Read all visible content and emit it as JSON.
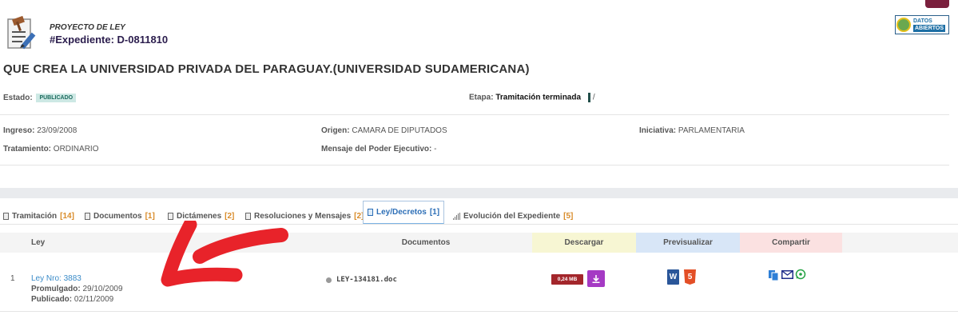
{
  "header": {
    "project_type": "PROYECTO DE LEY",
    "expediente": "#Expediente: D-0811810",
    "datos_line1": "DATOS",
    "datos_line2": "ABIERTOS",
    "title": "QUE CREA LA UNIVERSIDAD PRIVADA DEL PARAGUAY.(UNIVERSIDAD SUDAMERICANA)"
  },
  "status": {
    "estado_label": "Estado:",
    "estado_badge": "PUBLICADO",
    "etapa_label": "Etapa:",
    "etapa_value": "Tramitación terminada",
    "etapa_suffix": "/"
  },
  "info": {
    "ingreso_label": "Ingreso:",
    "ingreso_value": "23/09/2008",
    "origen_label": "Origen:",
    "origen_value": "CAMARA DE DIPUTADOS",
    "iniciativa_label": "Iniciativa:",
    "iniciativa_value": "PARLAMENTARIA",
    "tratamiento_label": "Tratamiento:",
    "tratamiento_value": "ORDINARIO",
    "mensaje_label": "Mensaje del Poder Ejecutivo:",
    "mensaje_value": "-"
  },
  "tabs": [
    {
      "label": "Tramitación",
      "count": "[14]"
    },
    {
      "label": "Documentos",
      "count": "[1]"
    },
    {
      "label": "Dictámenes",
      "count": "[2]"
    },
    {
      "label": "Resoluciones y Mensajes",
      "count": "[2]"
    },
    {
      "label": "Ley/Decretos",
      "count": "[1]"
    },
    {
      "label": "Evolución del Expediente",
      "count": "[5]"
    }
  ],
  "table": {
    "headers": {
      "ley": "Ley",
      "documentos": "Documentos",
      "descargar": "Descargar",
      "previsualizar": "Previsualizar",
      "compartir": "Compartir"
    },
    "rows": [
      {
        "index": "1",
        "ley_link": "Ley Nro: 3883",
        "promulgado_label": "Promulgado:",
        "promulgado_value": "29/10/2009",
        "publicado_label": "Publicado:",
        "publicado_value": "02/11/2009",
        "document": "LEY-134181.doc",
        "size": "0,24 MB",
        "word_letter": "W",
        "html_letter": "5"
      }
    ]
  },
  "colors": {
    "link": "#3a8bc8",
    "badge_bg": "#cde8e4",
    "tab_count": "#d98c2a",
    "download_purple": "#a53ac4",
    "size_red": "#a3262b",
    "annotation_arrow": "#e8232a"
  }
}
